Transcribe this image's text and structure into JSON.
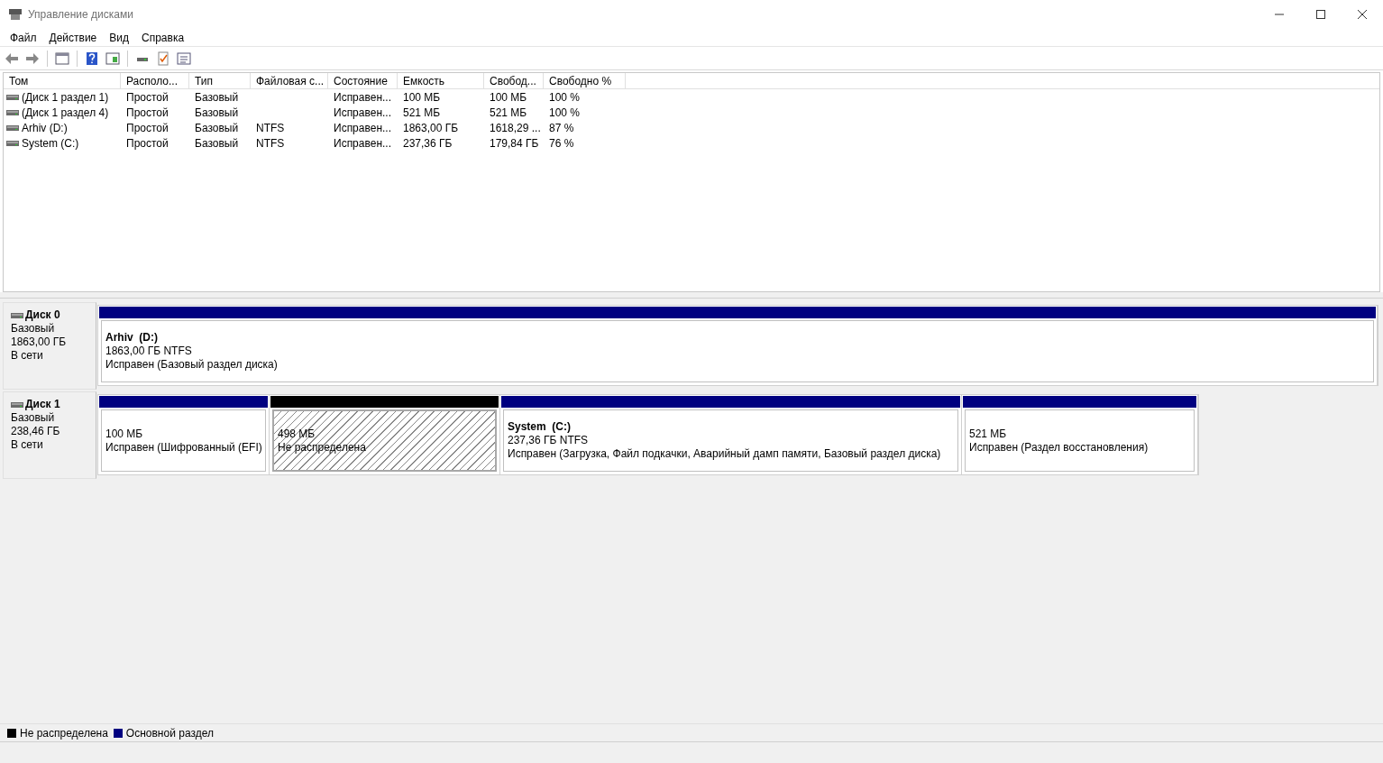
{
  "window": {
    "title": "Управление дисками"
  },
  "menu": [
    "Файл",
    "Действие",
    "Вид",
    "Справка"
  ],
  "table": {
    "columns": [
      "Том",
      "Располо...",
      "Тип",
      "Файловая с...",
      "Состояние",
      "Емкость",
      "Свобод...",
      "Свободно %"
    ],
    "rows": [
      [
        "(Диск 1 раздел 1)",
        "Простой",
        "Базовый",
        "",
        "Исправен...",
        "100 МБ",
        "100 МБ",
        "100 %"
      ],
      [
        "(Диск 1 раздел 4)",
        "Простой",
        "Базовый",
        "",
        "Исправен...",
        "521 МБ",
        "521 МБ",
        "100 %"
      ],
      [
        "Arhiv (D:)",
        "Простой",
        "Базовый",
        "NTFS",
        "Исправен...",
        "1863,00 ГБ",
        "1618,29 ...",
        "87 %"
      ],
      [
        "System (C:)",
        "Простой",
        "Базовый",
        "NTFS",
        "Исправен...",
        "237,36 ГБ",
        "179,84 ГБ",
        "76 %"
      ]
    ]
  },
  "disks": [
    {
      "name": "Диск 0",
      "type": "Базовый",
      "size": "1863,00 ГБ",
      "status": "В сети",
      "partitions": [
        {
          "kind": "primary",
          "label": "Arhiv  (D:)",
          "size": "1863,00 ГБ NTFS",
          "status": "Исправен (Базовый раздел диска)"
        }
      ]
    },
    {
      "name": "Диск 1",
      "type": "Базовый",
      "size": "238,46 ГБ",
      "status": "В сети",
      "partitions": [
        {
          "kind": "primary",
          "size": "100 МБ",
          "status": "Исправен (Шифрованный (EFI)"
        },
        {
          "kind": "unallocated",
          "size": "498 МБ",
          "status": "Не распределена"
        },
        {
          "kind": "primary",
          "label": "System  (C:)",
          "size": "237,36 ГБ NTFS",
          "status": "Исправен (Загрузка, Файл подкачки, Аварийный дамп памяти, Базовый раздел диска)"
        },
        {
          "kind": "primary",
          "size": "521 МБ",
          "status": "Исправен (Раздел восстановления)"
        }
      ]
    }
  ],
  "legend": [
    {
      "label": "Не распределена",
      "color": "#000000"
    },
    {
      "label": "Основной раздел",
      "color": "#000080"
    }
  ]
}
